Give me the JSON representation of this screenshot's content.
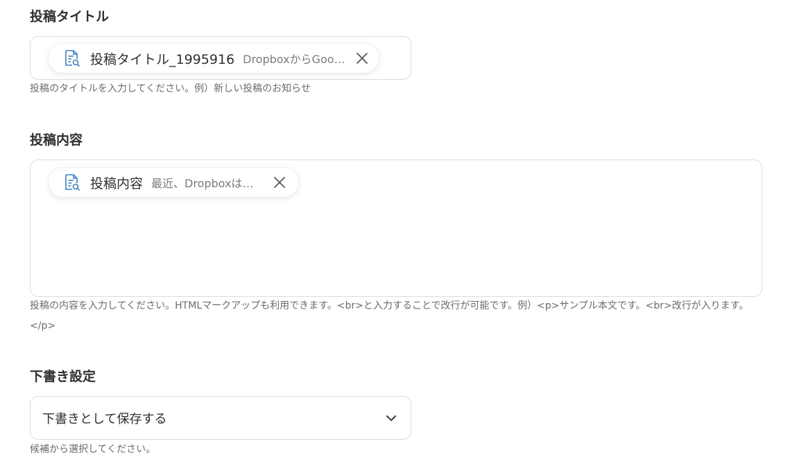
{
  "title_field": {
    "label": "投稿タイトル",
    "chip_icon": "document-search-icon",
    "chip_name": "投稿タイトル_1995916",
    "chip_value": "DropboxからGoog...",
    "helper": "投稿のタイトルを入力してください。例）新しい投稿のお知らせ"
  },
  "content_field": {
    "label": "投稿内容",
    "chip_icon": "document-search-icon",
    "chip_name": "投稿内容",
    "chip_value": "最近、Dropboxはフ...",
    "helper_line1": "投稿の内容を入力してください。HTMLマークアップも利用できます。<br>と入力することで改行が可能です。例）<p>サンプル本文です。<br>改行が入ります。",
    "helper_line2": "</p>"
  },
  "draft_field": {
    "label": "下書き設定",
    "selected": "下書きとして保存する",
    "chevron_icon": "chevron-down-icon",
    "helper": "候補から選択してください。"
  },
  "colors": {
    "border": "#d9dce0",
    "label": "#2f2f2f",
    "helper": "#6b6b6b"
  }
}
